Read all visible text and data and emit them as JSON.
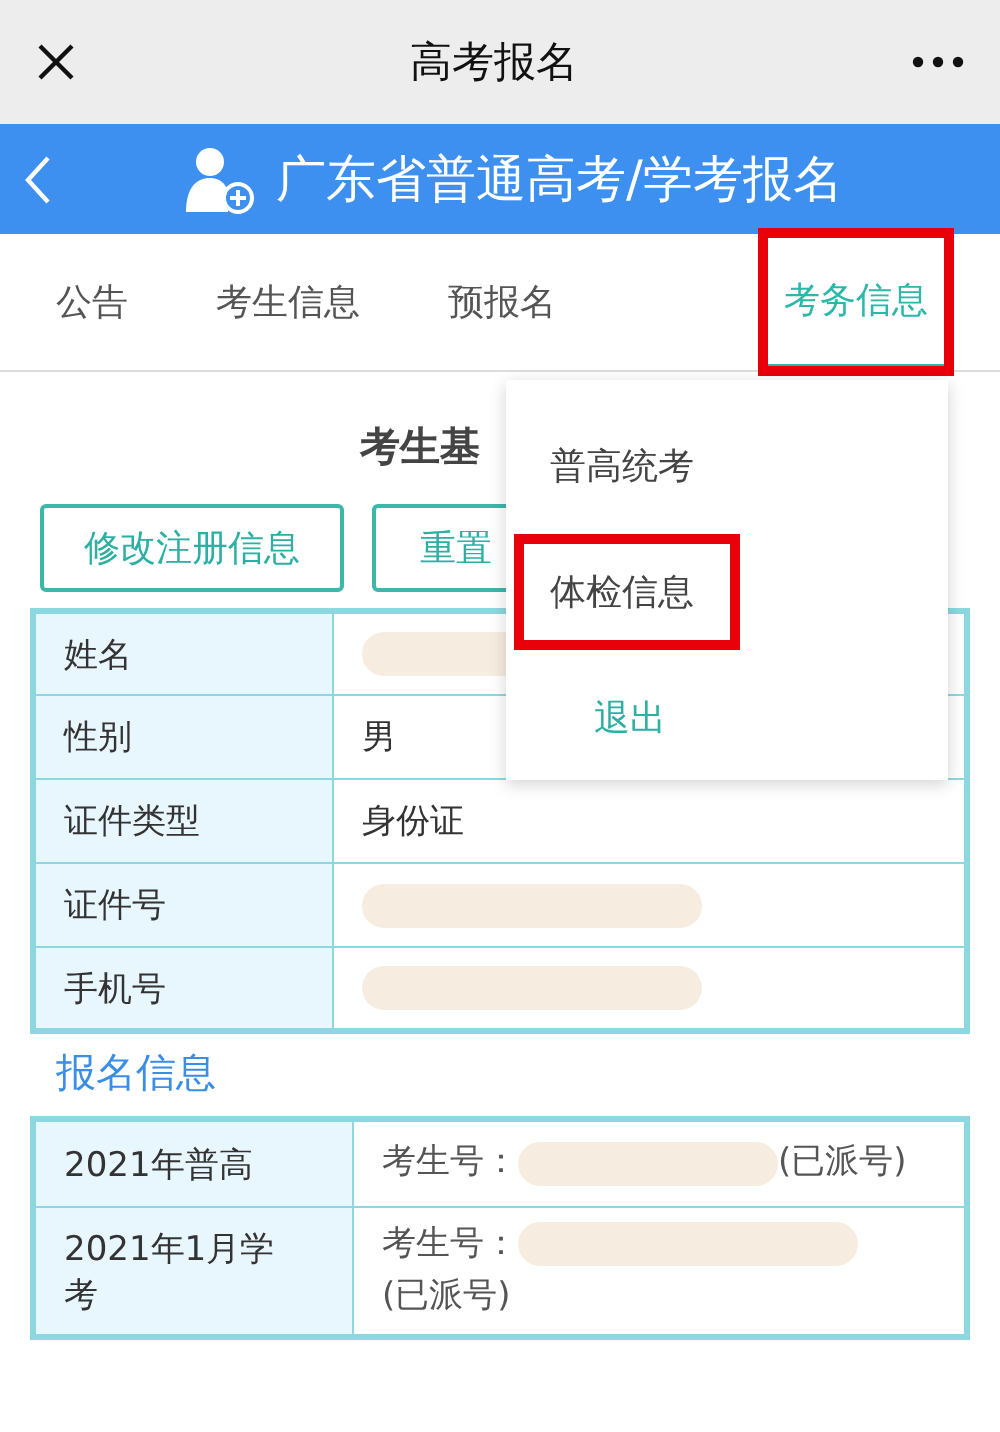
{
  "window": {
    "title": "高考报名"
  },
  "header": {
    "title": "广东省普通高考/学考报名"
  },
  "tabs": [
    {
      "label": "公告",
      "selected": false,
      "highlighted": false
    },
    {
      "label": "考生信息",
      "selected": false,
      "highlighted": false
    },
    {
      "label": "预报名",
      "selected": false,
      "highlighted": false
    },
    {
      "label": "考务信息",
      "selected": true,
      "highlighted": true
    }
  ],
  "section_title": "考生基",
  "buttons": [
    "修改注册信息",
    "重置"
  ],
  "info_rows": [
    {
      "label": "姓名",
      "kind": "redacted"
    },
    {
      "label": "性别",
      "kind": "text",
      "value": "男"
    },
    {
      "label": "证件类型",
      "kind": "text",
      "value": "身份证"
    },
    {
      "label": "证件号",
      "kind": "redacted"
    },
    {
      "label": "手机号",
      "kind": "redacted"
    }
  ],
  "registration": {
    "title": "报名信息",
    "rows": [
      {
        "label": "2021年普高",
        "prefix": "考生号：",
        "suffix": "(已派号)"
      },
      {
        "label": "2021年1月学考",
        "prefix": "考生号：",
        "suffix": "(已派号)"
      }
    ]
  },
  "dropdown": {
    "items": [
      {
        "label": "普高统考",
        "kind": "plain",
        "highlighted": false
      },
      {
        "label": "体检信息",
        "kind": "plain",
        "highlighted": true
      },
      {
        "label": "退出",
        "kind": "accent",
        "highlighted": false
      }
    ]
  }
}
